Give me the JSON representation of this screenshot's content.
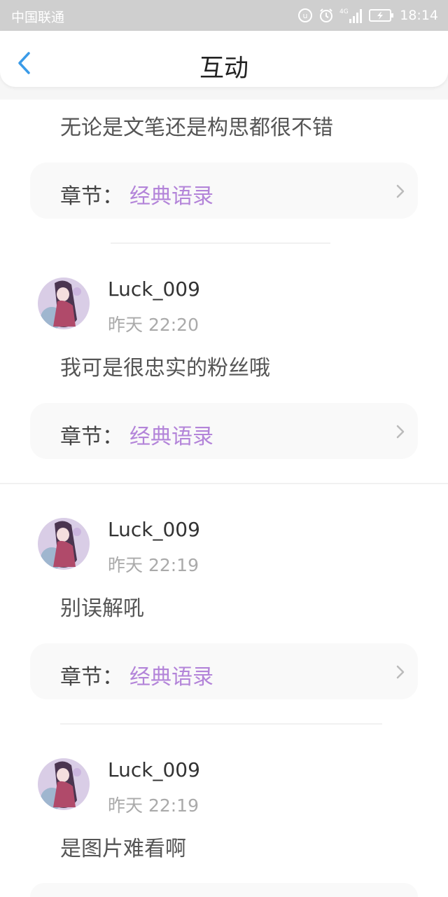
{
  "status_bar": {
    "carrier": "中国联通",
    "network": "4G",
    "time": "18:14"
  },
  "nav": {
    "back_icon": "chevron-left-icon",
    "title": "互动"
  },
  "colors": {
    "accent_back": "#3a9be8",
    "chapter_link": "#b384d9"
  },
  "items": [
    {
      "comment": "无论是文笔还是构思都很不错",
      "chapter_prefix": "章节：",
      "chapter_name": "经典语录"
    },
    {
      "username": "Luck_009",
      "time": "昨天 22:20",
      "comment": "我可是很忠实的粉丝哦",
      "chapter_prefix": "章节：",
      "chapter_name": "经典语录"
    },
    {
      "username": "Luck_009",
      "time": "昨天 22:19",
      "comment": "别误解吼",
      "chapter_prefix": "章节：",
      "chapter_name": "经典语录"
    },
    {
      "username": "Luck_009",
      "time": "昨天 22:19",
      "comment": "是图片难看啊"
    }
  ]
}
